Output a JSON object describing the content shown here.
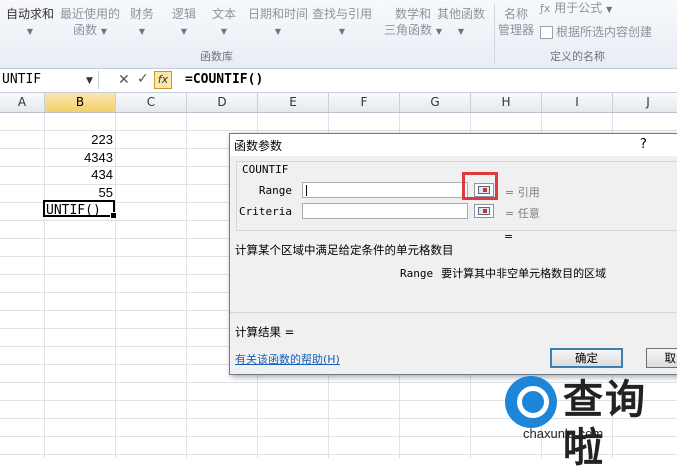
{
  "ribbon": {
    "autosum": "自动求和",
    "recent": "最近使用的",
    "recent_sub": "函数",
    "finance": "财务",
    "logic": "逻辑",
    "text": "文本",
    "datetime": "日期和时间",
    "lookup": "查找与引用",
    "math": "数学和",
    "math_sub": "三角函数",
    "other": "其他函数",
    "name_mgr": "名称",
    "name_mgr_sub": "管理器",
    "use_in_formula": "用于公式",
    "create_from_sel": "根据所选内容创建",
    "group_library": "函数库",
    "group_names": "定义的名称"
  },
  "formula_bar": {
    "name_box": "UNTIF",
    "fx": "fx",
    "formula": "=COUNTIF()"
  },
  "columns": [
    "A",
    "B",
    "C",
    "D",
    "E",
    "F",
    "G",
    "H",
    "I",
    "J"
  ],
  "cells": {
    "b1": "223",
    "b2": "4343",
    "b3": "434",
    "b4": "55",
    "active": "UNTIF()"
  },
  "dialog": {
    "title": "函数参数",
    "help_mark": "?",
    "function_name": "COUNTIF",
    "args": [
      {
        "label": "Range",
        "value": "",
        "result": "= 引用"
      },
      {
        "label": "Criteria",
        "value": "",
        "result": "= 任意"
      }
    ],
    "equals": "=",
    "description": "计算某个区域中满足给定条件的单元格数目",
    "arg_name": "Range",
    "arg_description": "要计算其中非空单元格数目的区域",
    "result_label": "计算结果 =",
    "help_link": "有关该函数的帮助(H)",
    "ok_label": "确定",
    "cancel_label": "取消"
  },
  "watermark": {
    "brand": "查询啦",
    "url": "chaxunla.com"
  }
}
